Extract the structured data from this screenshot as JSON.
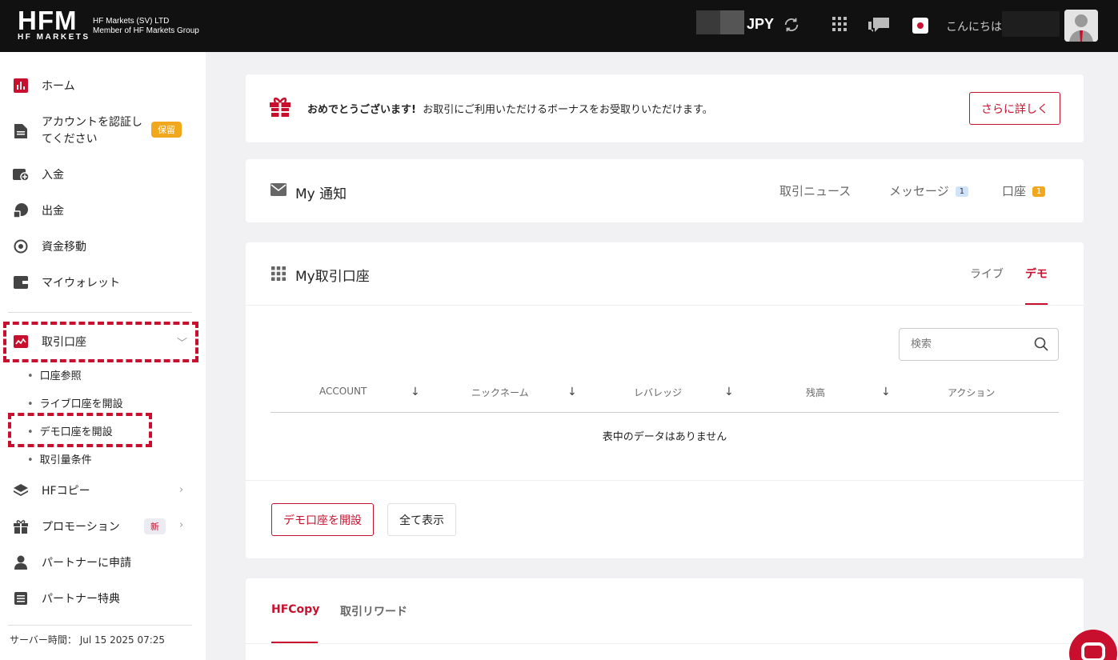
{
  "header": {
    "logo_text": "HFM",
    "logo_subtext": "HF MARKETS",
    "company_line1": "HF Markets (SV) LTD",
    "company_line2": "Member of HF Markets Group",
    "currency": "JPY",
    "greeting": "こんにちは"
  },
  "sidebar": {
    "items": [
      {
        "label": "ホーム",
        "icon": "chart-bar-icon"
      },
      {
        "label": "アカウントを認証し",
        "label2": "てください",
        "badge": "保留",
        "icon": "document-icon"
      },
      {
        "label": "入金",
        "icon": "deposit-icon"
      },
      {
        "label": "出金",
        "icon": "withdraw-icon"
      },
      {
        "label": "資金移動",
        "icon": "transfer-icon"
      },
      {
        "label": "マイウォレット",
        "icon": "wallet-icon"
      },
      {
        "label": "取引口座",
        "icon": "trading-account-icon"
      },
      {
        "label": "HFコピー",
        "icon": "layers-icon"
      },
      {
        "label": "プロモーション",
        "badge": "新",
        "icon": "gift-icon"
      },
      {
        "label": "パートナーに申請",
        "icon": "person-icon"
      },
      {
        "label": "パートナー特典",
        "icon": "list-icon"
      }
    ],
    "sub_items": [
      "口座参照",
      "ライブ口座を開設",
      "デモ口座を開設",
      "取引量条件"
    ],
    "server_time_label": "サーバー時間：",
    "server_time": "Jul 15 2025 07:25"
  },
  "bonus": {
    "title": "おめでとうございます!",
    "text": "お取引にご利用いただけるボーナスをお受取りいただけます。",
    "button": "さらに詳しく"
  },
  "notifications": {
    "title": "My 通知",
    "tabs": [
      {
        "label": "取引ニュース"
      },
      {
        "label": "メッセージ",
        "count": "1",
        "color": "#cfe3fb"
      },
      {
        "label": "口座",
        "count": "1",
        "color": "#f2a81d"
      }
    ]
  },
  "accounts": {
    "title": "My取引口座",
    "tabs": [
      "ライブ",
      "デモ"
    ],
    "active_tab": "デモ",
    "search_placeholder": "検索",
    "columns": [
      "ACCOUNT",
      "ニックネーム",
      "レバレッジ",
      "残高",
      "アクション"
    ],
    "empty_text": "表中のデータはありません",
    "btn_open_demo": "デモ口座を開設",
    "btn_show_all": "全て表示"
  },
  "bottom_tabs": [
    "HFCopy",
    "取引リワード"
  ],
  "colors": {
    "accent": "#c8102e",
    "topbar": "#111111",
    "badge_hold": "#f2a81d"
  }
}
